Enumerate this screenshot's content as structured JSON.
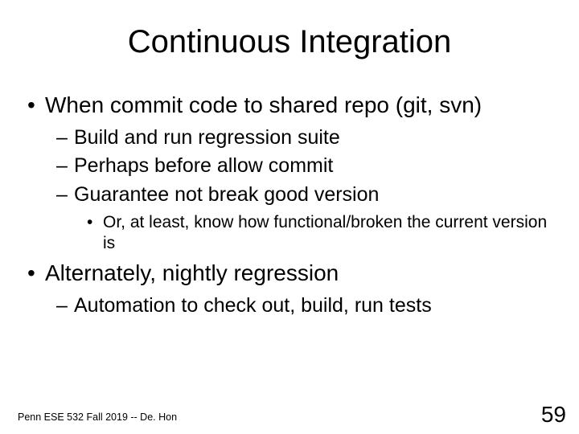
{
  "title": "Continuous Integration",
  "bullets": {
    "b1": "When commit code to shared repo (git, svn)",
    "b1_1": "Build and run regression suite",
    "b1_2": "Perhaps before allow commit",
    "b1_3": "Guarantee not break good version",
    "b1_3_1": "Or, at least, know how functional/broken the current version is",
    "b2": "Alternately, nightly regression",
    "b2_1": "Automation to check out, build, run tests"
  },
  "footer": {
    "left": "Penn ESE 532 Fall 2019 -- De. Hon",
    "page": "59"
  }
}
